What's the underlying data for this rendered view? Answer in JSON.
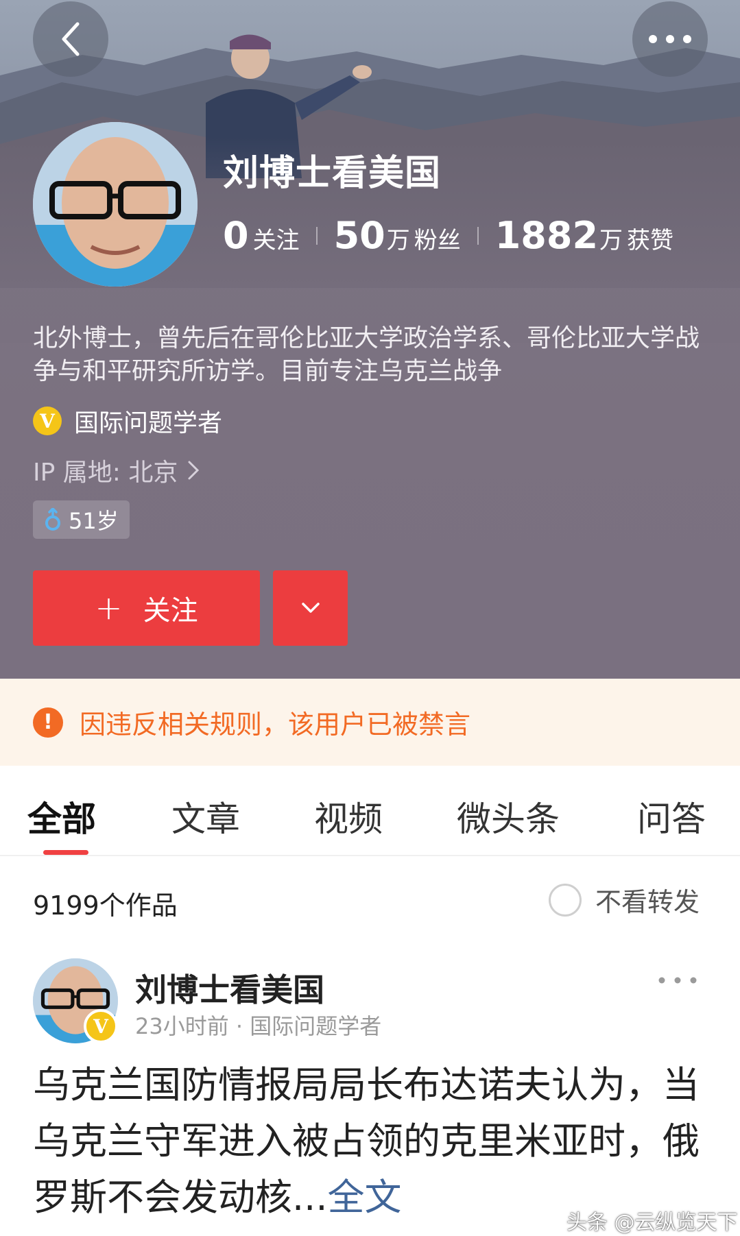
{
  "header": {
    "profile_name": "刘博士看美国",
    "stats": {
      "following_num": "0",
      "following_label": "关注",
      "fans_num": "50",
      "fans_unit": "万",
      "fans_label": "粉丝",
      "likes_num": "1882",
      "likes_unit": "万",
      "likes_label": "获赞"
    },
    "bio": "北外博士，曾先后在哥伦比亚大学政治学系、哥伦比亚大学战争与和平研究所访学。目前专注乌克兰战争",
    "verify_badge": "V",
    "verify_text": "国际问题学者",
    "ip_label": "IP 属地: 北京",
    "age_tag": "51岁",
    "follow_button": "关注",
    "follow_plus": "+"
  },
  "warning": {
    "icon": "!",
    "text": "因违反相关规则，该用户已被禁言"
  },
  "tabs": [
    "全部",
    "文章",
    "视频",
    "微头条",
    "问答"
  ],
  "works": {
    "count_text": "9199个作品",
    "filter_label": "不看转发"
  },
  "post": {
    "author": "刘博士看美国",
    "meta": "23小时前 · 国际问题学者",
    "verify_badge": "V",
    "body_text": "乌克兰国防情报局局长布达诺夫认为，当乌克兰守军进入被占领的克里米亚时，俄罗斯不会发动核...",
    "more_link": "全文"
  },
  "watermark": "头条 @云纵览天下",
  "colors": {
    "accent_red": "#ec3d3f",
    "warning_orange": "#f26a24",
    "verify_gold": "#f5c518",
    "link_blue": "#406599"
  },
  "icons": {
    "back": "chevron-left-icon",
    "more": "more-dots-icon",
    "ip_arrow": "chevron-right-icon",
    "gender": "male-icon",
    "dropdown": "chevron-down-icon"
  }
}
